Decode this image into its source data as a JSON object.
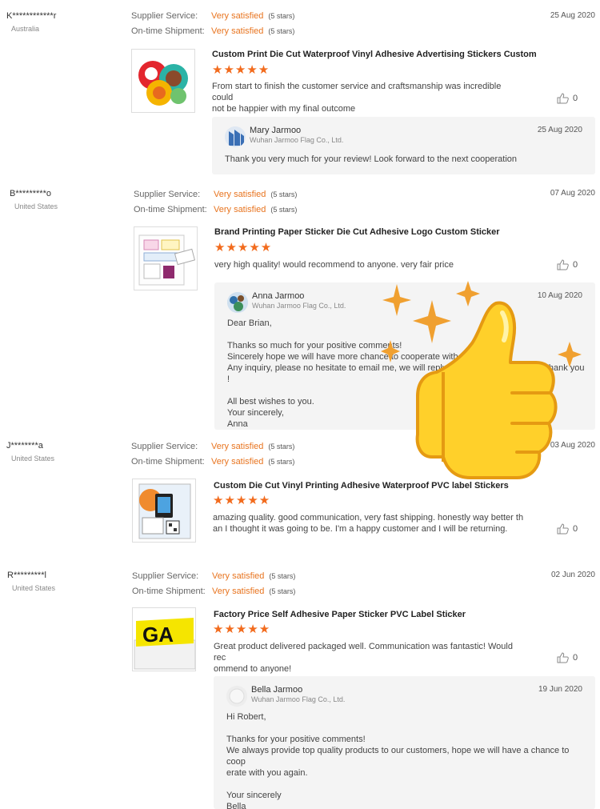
{
  "labels": {
    "supplier_service": "Supplier Service:",
    "ontime_shipment": "On-time Shipment:",
    "rating_value": "Very satisfied",
    "rating_stars": "(5 stars)"
  },
  "stars_glyph": "★★★★★",
  "accent_color": "#f26b1d",
  "reviews": [
    {
      "buyer": "K************r",
      "country": "Australia",
      "date": "25 Aug 2020",
      "product_title": "Custom Print Die Cut Waterproof Vinyl Adhesive Advertising Stickers Custom",
      "text": "From start to finish the customer service and craftsmanship was incredible could\nnot be happier with my final outcome",
      "likes": "0",
      "reply": {
        "name": "Mary Jarmoo",
        "company": "Wuhan Jarmoo Flag Co., Ltd.",
        "date": "25 Aug 2020",
        "text": "Thank you very much for your review! Look forward to the next cooperation"
      }
    },
    {
      "buyer": "B*********o",
      "country": "United States",
      "date": "07 Aug 2020",
      "product_title": "Brand Printing Paper Sticker Die Cut Adhesive Logo Custom Sticker",
      "text": "very high quality! would recommend to anyone. very fair price",
      "likes": "0",
      "reply": {
        "name": "Anna Jarmoo",
        "company": "Wuhan Jarmoo Flag Co., Ltd.",
        "date": "10 Aug 2020",
        "text": "Dear Brian,\n\nThanks so much for your positive comments!\nSincerely hope we will have more chance to cooperate with you again.\nAny inquiry, please no hesitate to email me, we will reply you as soon as we can. Thank you !\n\nAll best wishes to you.\nYour sincerely,\nAnna"
      }
    },
    {
      "buyer": "J********a",
      "country": "United States",
      "date": "03 Aug 2020",
      "product_title": "Custom Die Cut Vinyl Printing Adhesive Waterproof PVC label Stickers",
      "text": "amazing quality. good communication, very fast shipping.  honestly way better th\nan I thought it was going to be. I'm a happy customer and I will be returning.",
      "likes": "0"
    },
    {
      "buyer": "R*********l",
      "country": "United States",
      "date": "02 Jun 2020",
      "product_title": "Factory Price Self Adhesive Paper Sticker PVC Label Sticker",
      "text": "Great product delivered packaged well.  Communication was fantastic!  Would rec\nommend to anyone!",
      "likes": "0",
      "reply": {
        "name": "Bella Jarmoo",
        "company": "Wuhan Jarmoo Flag Co., Ltd.",
        "date": "19 Jun 2020",
        "text": "Hi Robert,\n\nThanks for your positive comments!\nWe always provide top quality products to our customers, hope we will have a chance to coop\nerate with you again.\n\nYour sincerely\nBella"
      }
    }
  ]
}
